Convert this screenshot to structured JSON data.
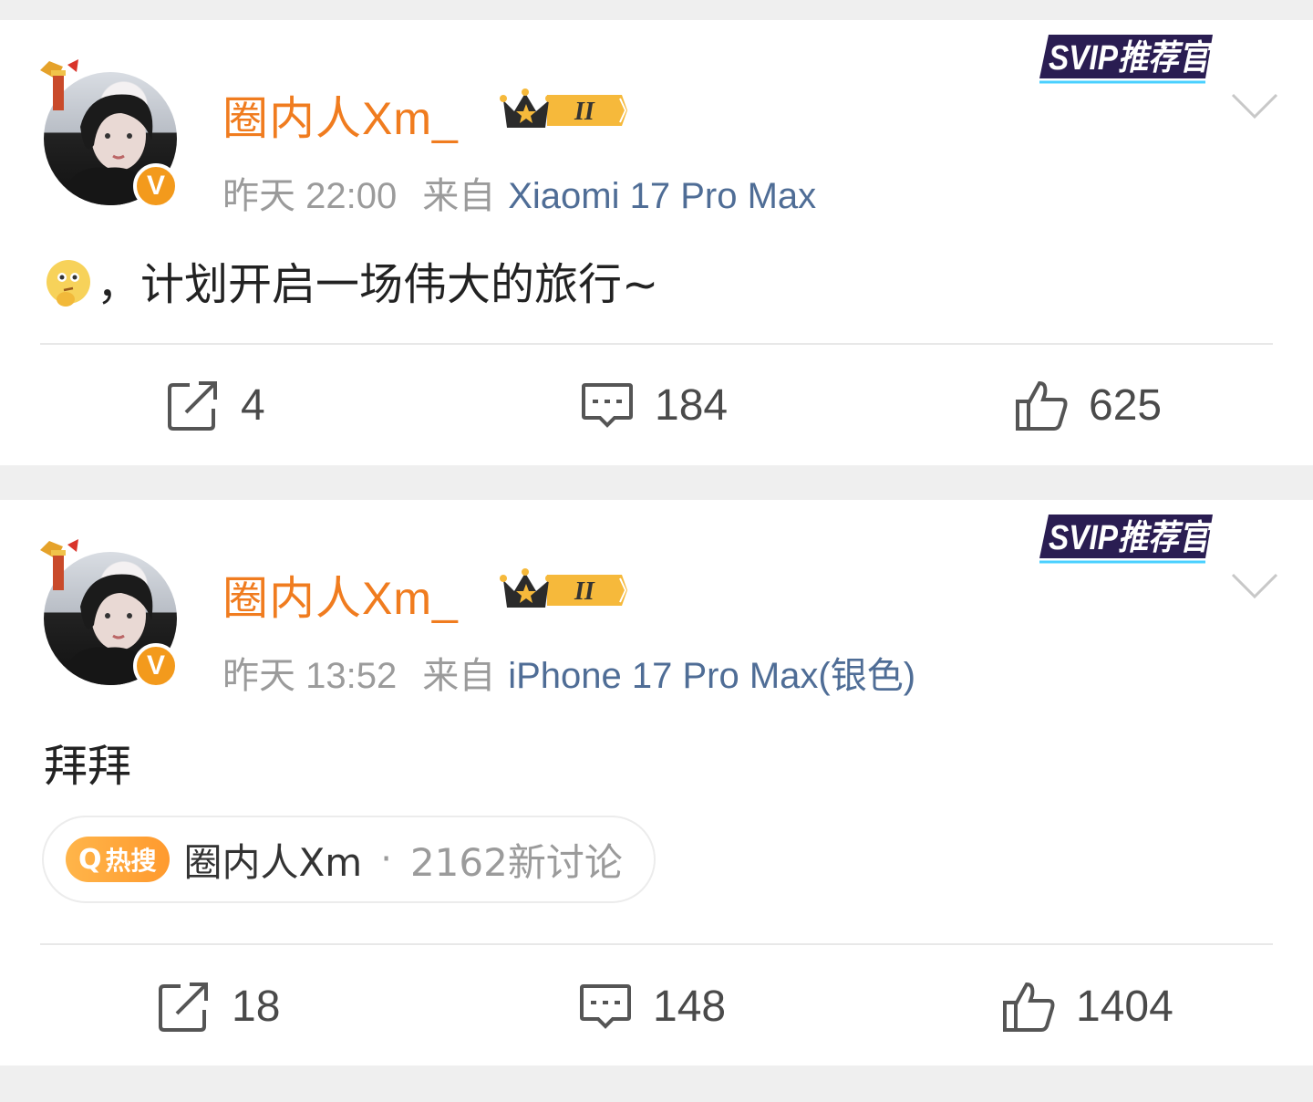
{
  "posts": [
    {
      "username": "圈内人Xm_",
      "time": "昨天 22:00",
      "source_prefix": "来自",
      "device": "Xiaomi 17 Pro Max",
      "text": "，计划开启一场伟大的旅行~",
      "svip_label": "SVIP推荐官",
      "verified_label": "V",
      "level_label": "II",
      "reposts": "4",
      "comments": "184",
      "likes": "625"
    },
    {
      "username": "圈内人Xm_",
      "time": "昨天 13:52",
      "source_prefix": "来自",
      "device": "iPhone 17 Pro Max(银色)",
      "text": "拜拜",
      "svip_label": "SVIP推荐官",
      "verified_label": "V",
      "level_label": "II",
      "hot_tag": "热搜",
      "hot_topic": "圈内人Xm",
      "hot_separator": "·",
      "hot_count": "2162新讨论",
      "reposts": "18",
      "comments": "148",
      "likes": "1404"
    }
  ],
  "colors": {
    "username": "#f07c1f",
    "device_link": "#4f6d96",
    "meta_gray": "#9b9b9b",
    "background": "#efefef"
  },
  "icons": {
    "repost": "repost-icon",
    "comment": "comment-icon",
    "like": "thumbs-up-icon",
    "more": "chevron-down-icon"
  }
}
